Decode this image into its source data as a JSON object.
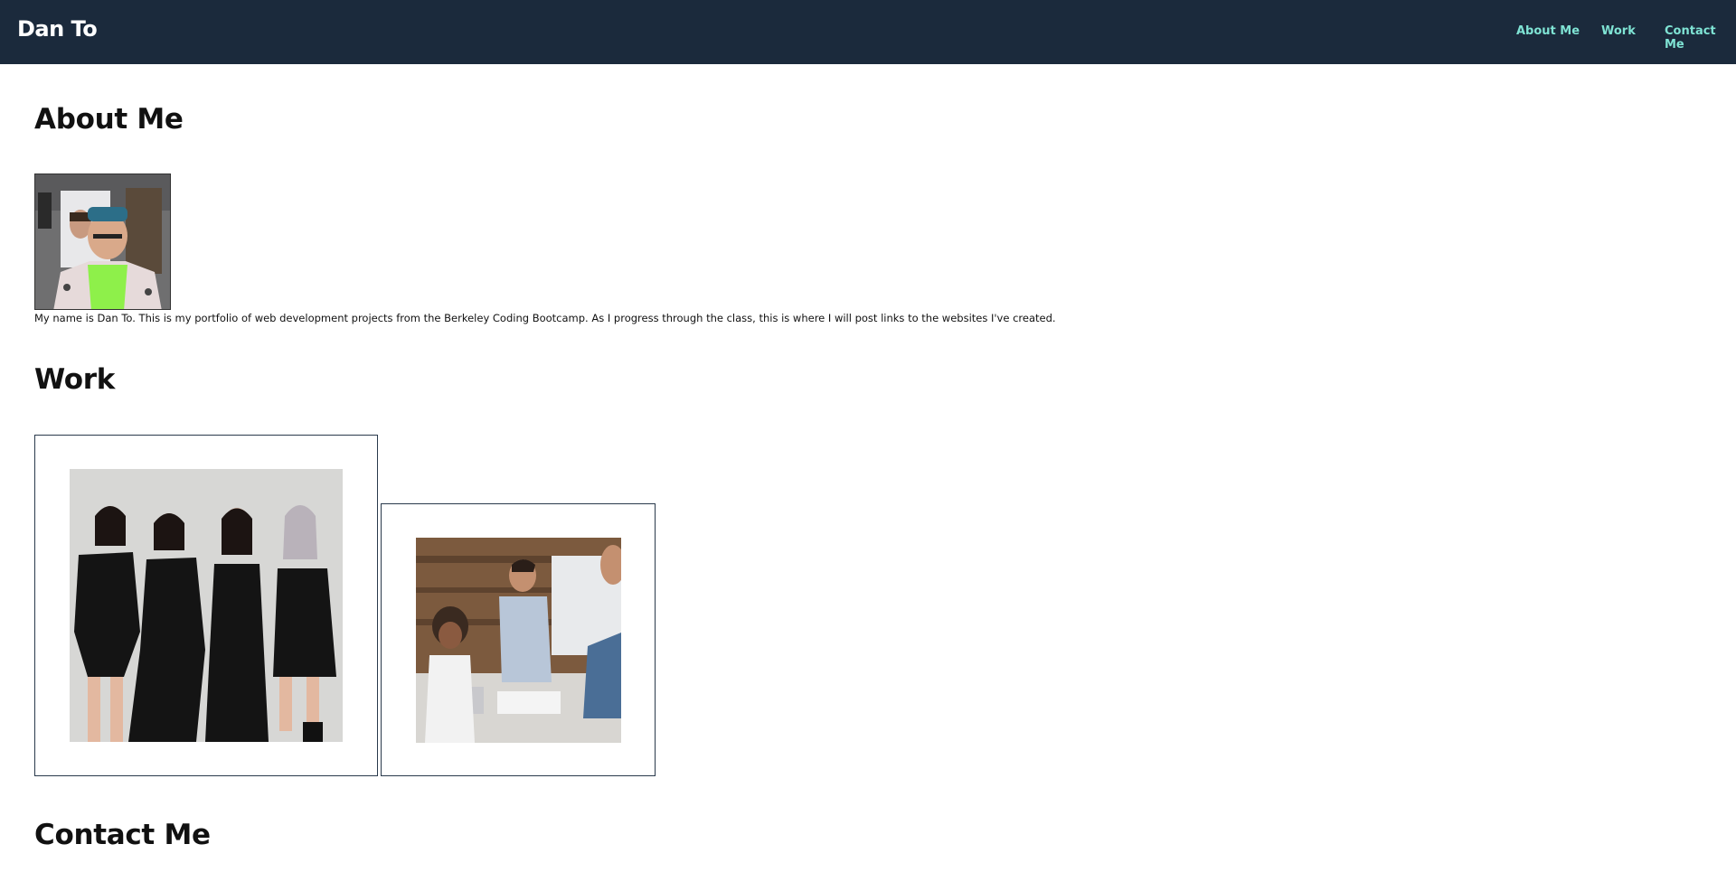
{
  "header": {
    "brand": "Dan To",
    "nav": {
      "about": "About Me",
      "work": "Work",
      "contact": "Contact Me"
    }
  },
  "about": {
    "heading": "About Me",
    "text": "My name is Dan To. This is my portfolio of web development projects from the Berkeley Coding Bootcamp. As I progress through the class, this is where I will post links to the websites I've created."
  },
  "work": {
    "heading": "Work"
  },
  "contact": {
    "heading": "Contact Me"
  },
  "colors": {
    "header_bg": "#1b2a3c",
    "nav_link": "#7fe3d4",
    "brand": "#ffffff"
  }
}
